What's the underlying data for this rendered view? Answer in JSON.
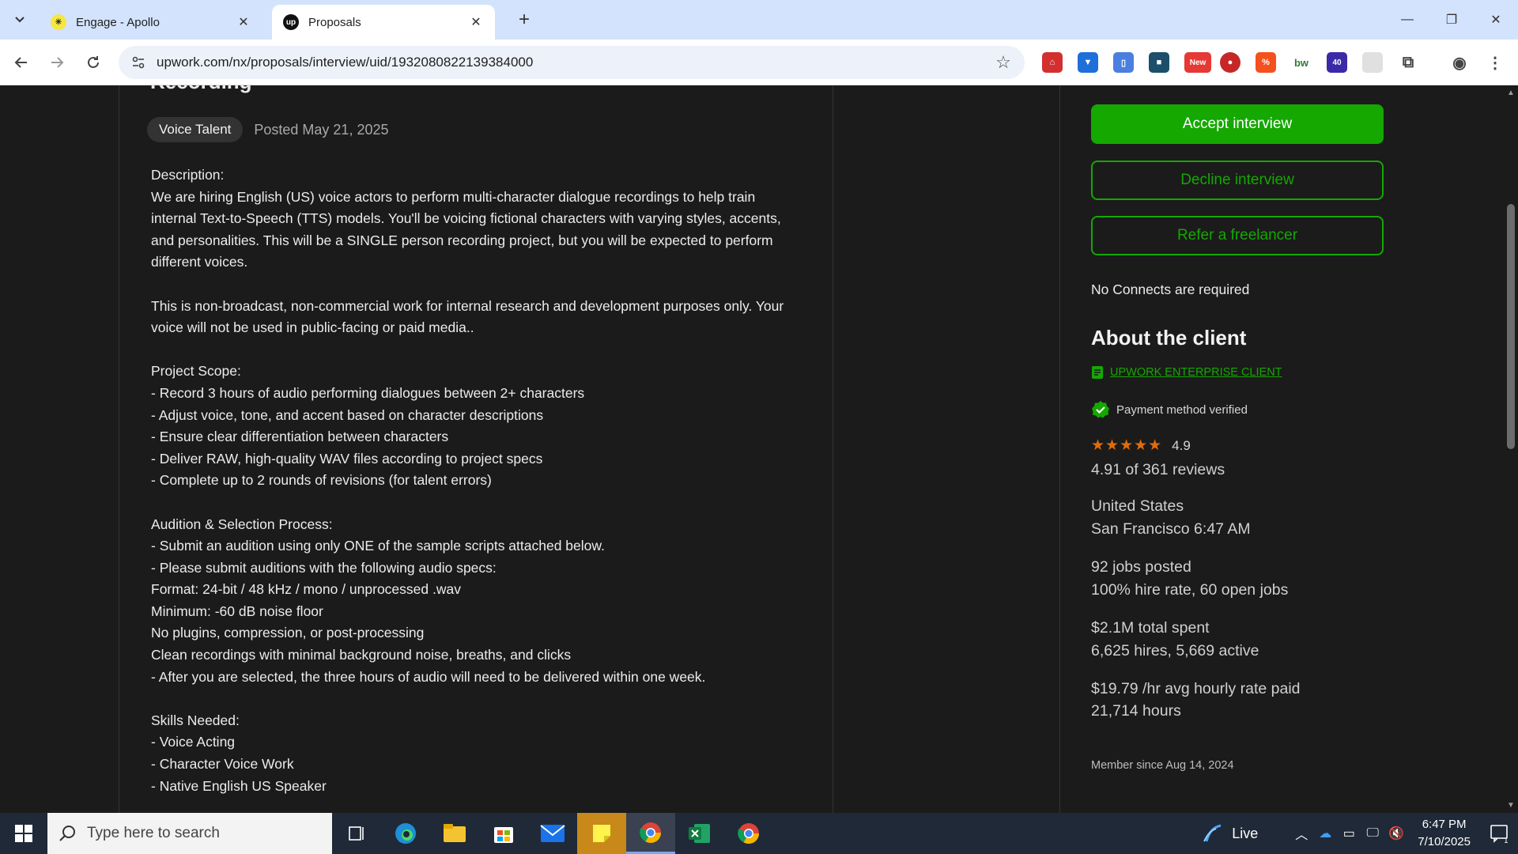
{
  "browser": {
    "tabs": [
      {
        "title": "Engage - Apollo",
        "active": false
      },
      {
        "title": "Proposals",
        "active": true
      }
    ],
    "url": "upwork.com/nx/proposals/interview/uid/1932080822139384000",
    "extension_badges": {
      "new": "New",
      "count": "40"
    }
  },
  "job": {
    "title_partial": "Recording",
    "category": "Voice Talent",
    "posted": "Posted May 21, 2025",
    "description": [
      "Description:\nWe are hiring English (US) voice actors to perform multi-character dialogue recordings to help train internal Text-to-Speech (TTS) models. You'll be voicing fictional characters with varying styles, accents, and personalities. This will be a SINGLE person recording project, but you will be expected to perform different voices.",
      "This is non-broadcast, non-commercial work for internal research and development purposes only. Your voice will not be used in public-facing or paid media..",
      "Project Scope:\n- Record 3 hours of audio performing dialogues between 2+ characters\n- Adjust voice, tone, and accent based on character descriptions\n- Ensure clear differentiation between characters\n- Deliver RAW, high-quality WAV files according to project specs\n- Complete up to 2 rounds of revisions (for talent errors)",
      "Audition & Selection Process:\n- Submit an audition using only ONE of the sample scripts attached below.\n- Please submit auditions with the following audio specs:\nFormat: 24-bit / 48 kHz / mono / unprocessed .wav\nMinimum: -60 dB noise floor\nNo plugins, compression, or post-processing\nClean recordings with minimal background noise, breaths, and clicks\n- After you are selected, the three hours of audio will need to be delivered within one week.",
      "Skills Needed:\n- Voice Acting\n- Character Voice Work\n- Native English US Speaker"
    ]
  },
  "sidebar": {
    "accept_label": "Accept interview",
    "decline_label": "Decline interview",
    "refer_label": "Refer a freelancer",
    "connects_text": "No Connects are required",
    "about_title": "About the client",
    "enterprise_label": "UPWORK ENTERPRISE CLIENT",
    "payment_text": "Payment method verified",
    "rating_stars": 5,
    "rating_value": "4.9",
    "reviews_text": "4.91 of 361 reviews",
    "country": "United States",
    "city_time": "San Francisco 6:47 AM",
    "jobs_posted": "92 jobs posted",
    "hire_rate": "100% hire rate, 60 open jobs",
    "total_spent": "$2.1M total spent",
    "hires": "6,625 hires, 5,669 active",
    "avg_rate": "$19.79 /hr avg hourly rate paid",
    "hours": "21,714 hours",
    "member_since": "Member since Aug 14, 2024"
  },
  "taskbar": {
    "search_placeholder": "Type here to search",
    "live_label": "Live",
    "time": "6:47 PM",
    "date": "7/10/2025",
    "notification_count": "1"
  },
  "colors": {
    "upwork_green": "#14a800",
    "star_orange": "#e06c0a",
    "page_bg": "#1b1b1b",
    "tabstrip_bg": "#d3e3fd"
  }
}
